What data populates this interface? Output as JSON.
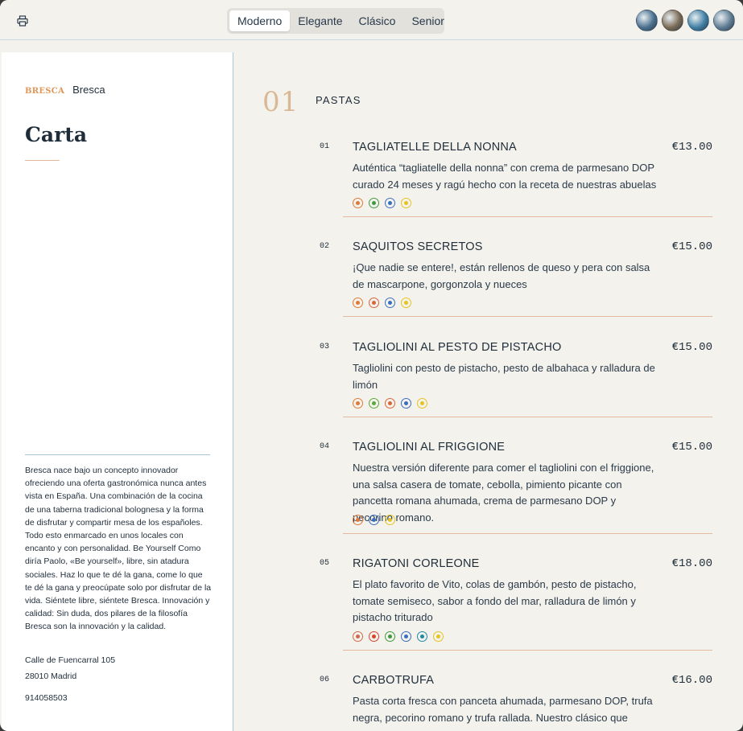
{
  "toolbar": {
    "print_icon": "printer-icon",
    "tabs": [
      "Moderno",
      "Elegante",
      "Clásico",
      "Senior"
    ],
    "active_tab": "Moderno",
    "swatches": [
      {
        "name": "theme-swatch-1",
        "color": "#4a6f8e"
      },
      {
        "name": "theme-swatch-2",
        "color": "#7a6a55"
      },
      {
        "name": "theme-swatch-3",
        "color": "#3f7ea3"
      },
      {
        "name": "theme-swatch-4",
        "color": "#5e7c93"
      }
    ]
  },
  "sidebar": {
    "logo_text": "BRESCA",
    "brand_name": "Bresca",
    "title": "Carta",
    "about": "Bresca nace bajo un concepto innovador ofreciendo una oferta gastronómica nunca antes vista en España. Una combinación de la cocina de una taberna tradicional bolognesa y la forma de disfrutar y compartir mesa de los españoles. Todo esto enmarcado en unos locales con encanto y con personalidad. Be Yourself Como diría Paolo, «Be yourself», libre, sin atadura sociales. Haz lo que te dé la gana, come lo que te dé la gana y preocúpate solo por disfrutar de la vida. Siéntete libre, siéntete Bresca. Innovación y calidad: Sin duda, dos pilares de la filosofía Bresca son la innovación y la calidad.",
    "address_line1": "Calle de Fuencarral 105",
    "address_line2": "28010 Madrid",
    "phone": "914058503"
  },
  "section": {
    "number": "01",
    "title": "PASTAS"
  },
  "items": [
    {
      "num": "01",
      "name": "TAGLIATELLE DELLA NONNA",
      "price": "€13.00",
      "desc": "Auténtica “tagliatelle della nonna” con crema de parmesano DOP curado 24 meses y ragú hecho con la receta de nuestras abuelas",
      "allergens": [
        "#e07a3a",
        "#3f9a3f",
        "#3a6fc0",
        "#e6c420"
      ]
    },
    {
      "num": "02",
      "name": "SAQUITOS SECRETOS",
      "price": "€15.00",
      "desc": "¡Que nadie se entere!, están rellenos de queso y pera con salsa de mascarpone, gorgonzola y nueces",
      "allergens": [
        "#e07a3a",
        "#d9653a",
        "#3a6fc0",
        "#e6c420"
      ]
    },
    {
      "num": "03",
      "name": "TAGLIOLINI AL PESTO DE PISTACHO",
      "price": "€15.00",
      "desc": "Tagliolini con pesto de pistacho, pesto de albahaca y ralladura de limón",
      "allergens": [
        "#e07a3a",
        "#5aa83a",
        "#d9653a",
        "#3a6fc0",
        "#e6c420"
      ]
    },
    {
      "num": "04",
      "name": "TAGLIOLINI AL FRIGGIONE",
      "price": "€15.00",
      "desc": "Nuestra versión diferente para comer el tagliolini con el friggione, una salsa casera de tomate, cebolla, pimiento picante con pancetta romana ahumada, crema de parmesano DOP y pecorino romano.",
      "allergens": [
        "#e07a3a",
        "#3a6fc0",
        "#e6c420"
      ]
    },
    {
      "num": "05",
      "name": "RIGATONI CORLEONE",
      "price": "€18.00",
      "desc": "El plato favorito de Vito, colas de gambón, pesto de pistacho, tomate semiseco, sabor a fondo del mar, ralladura de limón y pistacho triturado",
      "allergens": [
        "#d06a4a",
        "#d9452a",
        "#3f9a3f",
        "#3a6fc0",
        "#1f8aa8",
        "#e6c420"
      ]
    },
    {
      "num": "06",
      "name": "CARBOTRUFA",
      "price": "€16.00",
      "desc": "Pasta corta fresca con panceta ahumada, parmesano DOP, trufa negra, pecorino romano y trufa rallada. Nuestro clásico que nunca",
      "allergens": []
    }
  ]
}
